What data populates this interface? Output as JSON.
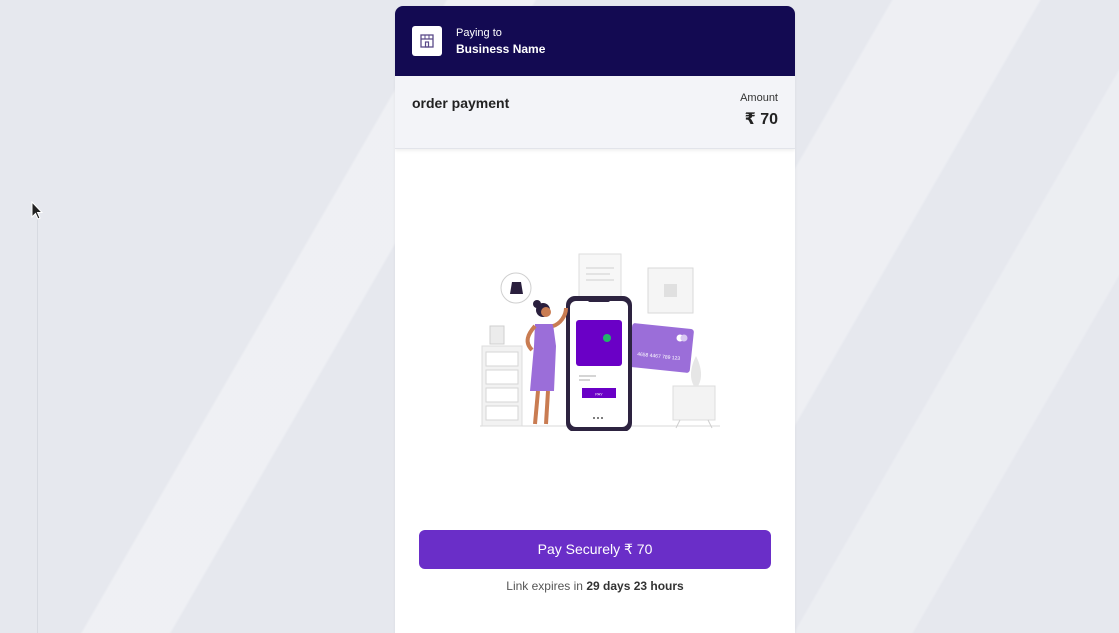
{
  "header": {
    "paying_to_label": "Paying to",
    "business_name": "Business Name",
    "store_icon": "store-icon"
  },
  "summary": {
    "description": "order payment",
    "amount_label": "Amount",
    "amount_value": "₹ 70"
  },
  "payment": {
    "button_label": "Pay Securely ₹ 70",
    "expiry_prefix": "Link expires in",
    "expiry_value": "29 days 23 hours"
  },
  "illustration": {
    "card_number": "4658 4467 789 123",
    "phone_button_label": "PAY"
  },
  "colors": {
    "header_bg": "#130a52",
    "accent": "#6a2ec8",
    "summary_bg": "#f3f4f8"
  }
}
